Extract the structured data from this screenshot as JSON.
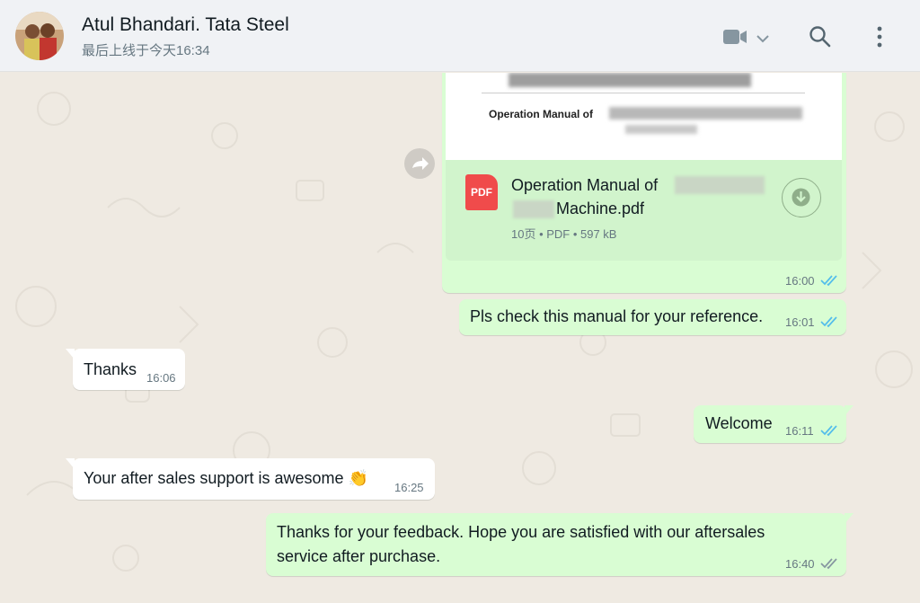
{
  "header": {
    "contact_name": "Atul Bhandari. Tata Steel",
    "last_seen": "最后上线于今天16:34",
    "icons": [
      "video-call-icon",
      "chevron-down-icon",
      "search-icon",
      "menu-icon"
    ]
  },
  "messages": {
    "doc": {
      "preview_heading": "Operation Manual of",
      "file_name_line1": "Operation Manual of",
      "file_name_line2": "Machine.pdf",
      "file_badge": "PDF",
      "file_meta": "10页 • PDF • 597 kB",
      "time": "16:00"
    },
    "m1": {
      "text": "Pls check this manual for your reference.",
      "time": "16:01"
    },
    "m2": {
      "text": "Thanks",
      "time": "16:06"
    },
    "m3": {
      "text": "Welcome",
      "time": "16:11"
    },
    "m4": {
      "text": "Your after sales support is awesome 👏",
      "time": "16:25"
    },
    "m5": {
      "text_line1": "Thanks for your feedback. Hope you are satisfied with our aftersales",
      "text_line2": "service after purchase.",
      "time": "16:40"
    }
  },
  "colors": {
    "outgoing_bubble": "#d9fdd3",
    "incoming_bubble": "#ffffff",
    "read_ticks": "#53bdeb",
    "delivered_ticks": "#8696a0",
    "chat_background": "#efeae2"
  }
}
